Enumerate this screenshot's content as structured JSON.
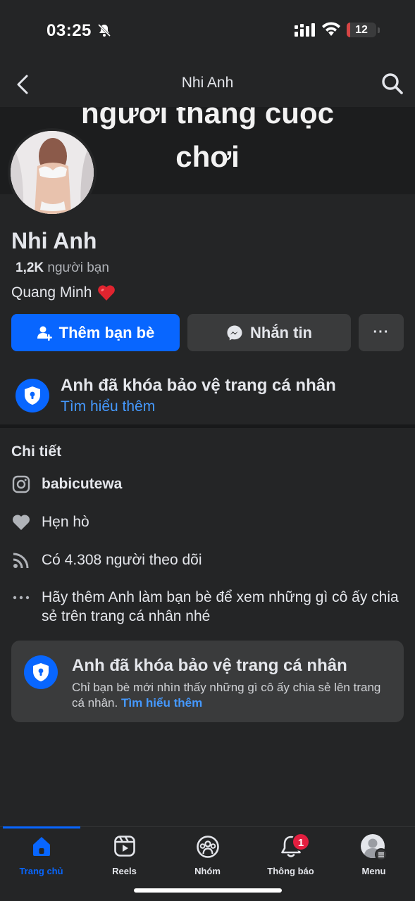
{
  "status_bar": {
    "time": "03:25",
    "battery": "12",
    "battery_fraction": 0.12
  },
  "header": {
    "title": "Nhi Anh"
  },
  "cover": {
    "text": "người thắng cuộc\nchơi"
  },
  "profile": {
    "name": "Nhi Anh",
    "friends_count": "1,2K",
    "friends_label": "người bạn",
    "bio": "Quang Minh",
    "bio_emoji": "❤️"
  },
  "actions": {
    "add_friend": "Thêm bạn bè",
    "message": "Nhắn tin",
    "more": "···"
  },
  "lock_banner": {
    "title": "Anh đã khóa bảo vệ trang cá nhân",
    "link": "Tìm hiểu thêm"
  },
  "details": {
    "heading": "Chi tiết",
    "items": [
      {
        "icon": "instagram-icon",
        "text": "babicutewa",
        "bold": true
      },
      {
        "icon": "heart-icon",
        "text": "Hẹn hò"
      },
      {
        "icon": "rss-icon",
        "text": "Có 4.308 người theo dõi"
      },
      {
        "icon": "more-dots-icon",
        "text": "Hãy thêm Anh làm bạn bè để xem những gì cô ấy chia sẻ trên trang cá nhân nhé"
      }
    ]
  },
  "lock_card": {
    "title": "Anh đã khóa bảo vệ trang cá nhân",
    "desc": "Chỉ bạn bè mới nhìn thấy những gì cô ấy chia sẻ lên trang cá nhân.",
    "link": "Tìm hiểu thêm"
  },
  "tabbar": {
    "tabs": [
      {
        "label": "Trang chủ",
        "icon": "home-icon",
        "active": true
      },
      {
        "label": "Reels",
        "icon": "reels-icon"
      },
      {
        "label": "Nhóm",
        "icon": "groups-icon"
      },
      {
        "label": "Thông báo",
        "icon": "bell-icon",
        "badge": "1"
      },
      {
        "label": "Menu",
        "icon": "menu-avatar-icon"
      }
    ]
  },
  "colors": {
    "accent": "#0866ff",
    "link": "#4599ff",
    "background": "#242526",
    "badge": "#e41e3f"
  }
}
